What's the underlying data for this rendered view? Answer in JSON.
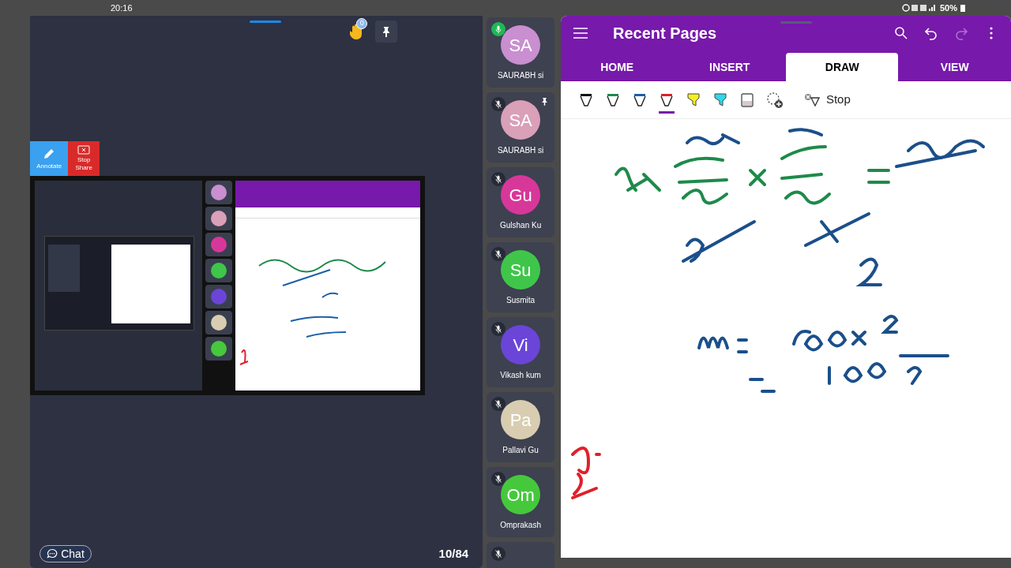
{
  "status_bar": {
    "time": "20:16",
    "battery": "50%"
  },
  "class_bar": {
    "raised_hands": "0"
  },
  "shared_screen": {
    "buttons": [
      {
        "kind": "annotate",
        "label": "Annotate"
      },
      {
        "kind": "stop",
        "label": "Stop Share"
      }
    ]
  },
  "participants": [
    {
      "initials": "SA",
      "name": "SAURABH si",
      "color": "#c98fd0",
      "mic_on": true,
      "pinned": false
    },
    {
      "initials": "SA",
      "name": "SAURABH si",
      "color": "#d9a0b8",
      "mic_on": false,
      "pinned": true
    },
    {
      "initials": "Gu",
      "name": "Gulshan Ku",
      "color": "#d8379a",
      "mic_on": false,
      "pinned": false
    },
    {
      "initials": "Su",
      "name": "Susmita",
      "color": "#3fc64a",
      "mic_on": false,
      "pinned": false
    },
    {
      "initials": "Vi",
      "name": "Vikash kum",
      "color": "#6a45d8",
      "mic_on": false,
      "pinned": false
    },
    {
      "initials": "Pa",
      "name": "Pallavi Gu",
      "color": "#d8cdb0",
      "mic_on": false,
      "pinned": false
    },
    {
      "initials": "Om",
      "name": "Omprakash",
      "color": "#46c83c",
      "mic_on": false,
      "pinned": false
    },
    {
      "mic_on": false,
      "pinned": false
    }
  ],
  "footer": {
    "chat": "Chat",
    "page": "10/84"
  },
  "notebook": {
    "title": "Recent Pages",
    "actions": [
      {
        "kind": "search",
        "disabled": false
      },
      {
        "kind": "undo",
        "disabled": false
      },
      {
        "kind": "redo",
        "disabled": true
      },
      {
        "kind": "more",
        "disabled": false
      }
    ],
    "tabs": [
      {
        "label": "HOME",
        "selected": false
      },
      {
        "label": "INSERT",
        "selected": false
      },
      {
        "label": "DRAW",
        "selected": true
      },
      {
        "label": "VIEW",
        "selected": false
      }
    ],
    "tools": [
      {
        "kind": "pen",
        "color": "#111111",
        "selected": false
      },
      {
        "kind": "pen",
        "color": "#1e8a4a",
        "selected": false
      },
      {
        "kind": "pen",
        "color": "#1d5fa8",
        "selected": false
      },
      {
        "kind": "pen",
        "color": "#e0202a",
        "selected": true
      },
      {
        "kind": "highlighter",
        "color": "#f4f020",
        "selected": false
      },
      {
        "kind": "highlighter",
        "color": "#30d8e8",
        "selected": false
      },
      {
        "kind": "eraser",
        "selected": false
      },
      {
        "kind": "lasso",
        "selected": false
      }
    ],
    "stop_label": "Stop"
  }
}
